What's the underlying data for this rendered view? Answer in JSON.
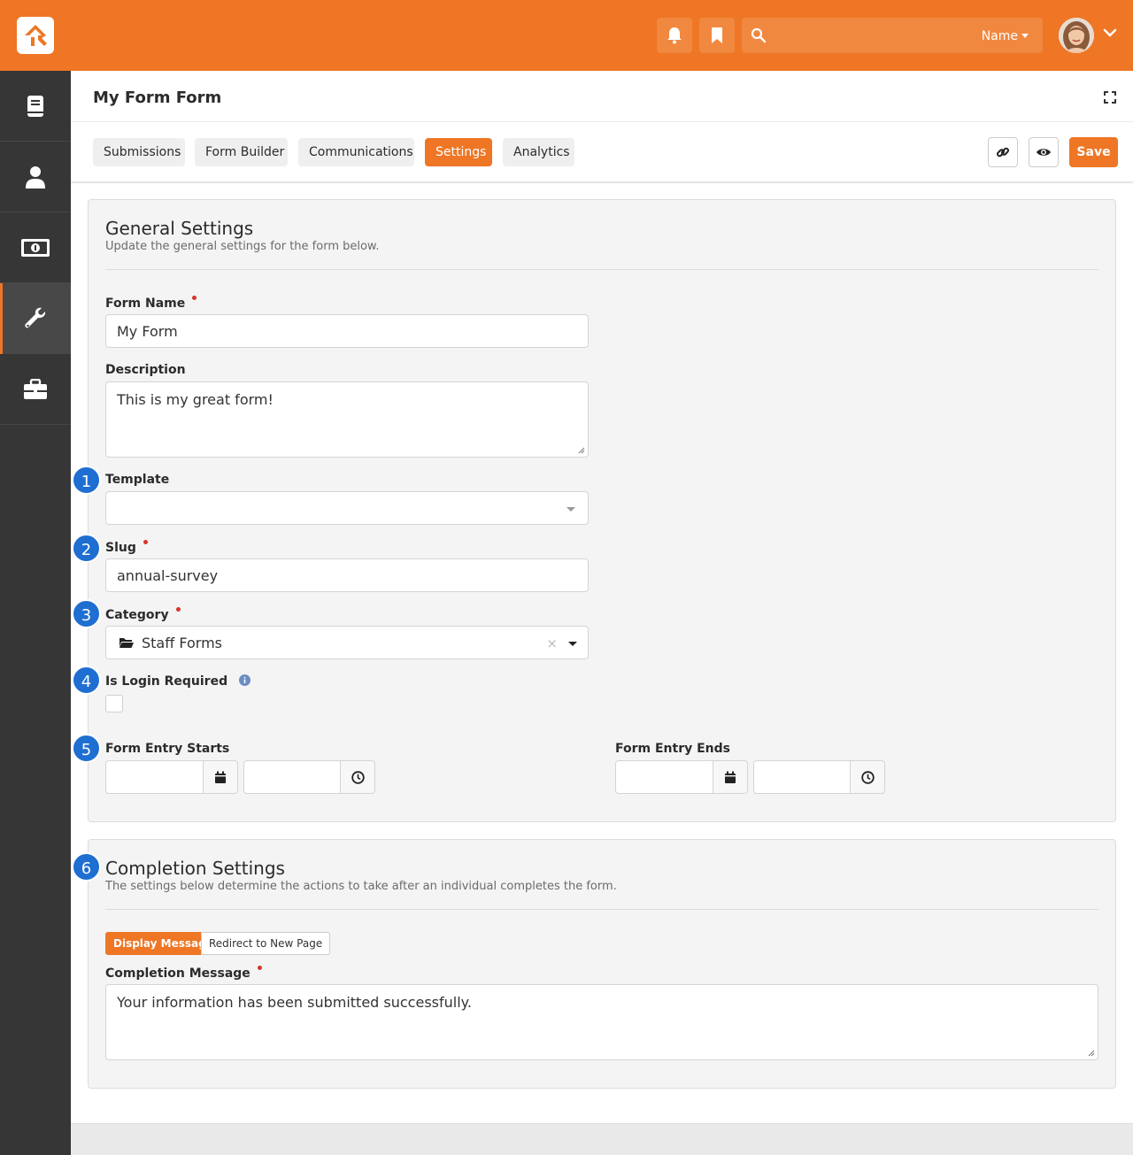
{
  "header": {
    "search_user_label": "Name",
    "icons": [
      "bell-icon",
      "bookmark-icon",
      "search-icon",
      "chevron-down-icon"
    ],
    "accent_color": "#ee7625"
  },
  "sidebar": {
    "items": [
      {
        "icon": "book-icon",
        "active": false
      },
      {
        "icon": "person-icon",
        "active": false
      },
      {
        "icon": "money-icon",
        "active": false
      },
      {
        "icon": "wrench-icon",
        "active": true
      },
      {
        "icon": "briefcase-icon",
        "active": false
      }
    ]
  },
  "page": {
    "title": "My Form Form",
    "tabs": [
      {
        "label": "Submissions",
        "active": false
      },
      {
        "label": "Form Builder",
        "active": false
      },
      {
        "label": "Communications",
        "active": false
      },
      {
        "label": "Settings",
        "active": true
      },
      {
        "label": "Analytics",
        "active": false
      }
    ],
    "save_label": "Save"
  },
  "general": {
    "title": "General Settings",
    "subtitle": "Update the general settings for the form below.",
    "form_name_label": "Form Name",
    "form_name_value": "My Form",
    "description_label": "Description",
    "description_value": "This is my great form!",
    "template_label": "Template",
    "template_value": "",
    "slug_label": "Slug",
    "slug_value": "annual-survey",
    "category_label": "Category",
    "category_value": "Staff Forms",
    "login_label": "Is Login Required",
    "login_checked": false,
    "entry_starts_label": "Form Entry Starts",
    "entry_ends_label": "Form Entry Ends"
  },
  "completion": {
    "title": "Completion Settings",
    "subtitle": "The settings below determine the actions to take after an individual completes the form.",
    "option_display": "Display Message",
    "option_redirect": "Redirect to New Page",
    "message_label": "Completion Message",
    "message_value": "Your information has been submitted successfully."
  },
  "badges": [
    "1",
    "2",
    "3",
    "4",
    "5",
    "6"
  ]
}
